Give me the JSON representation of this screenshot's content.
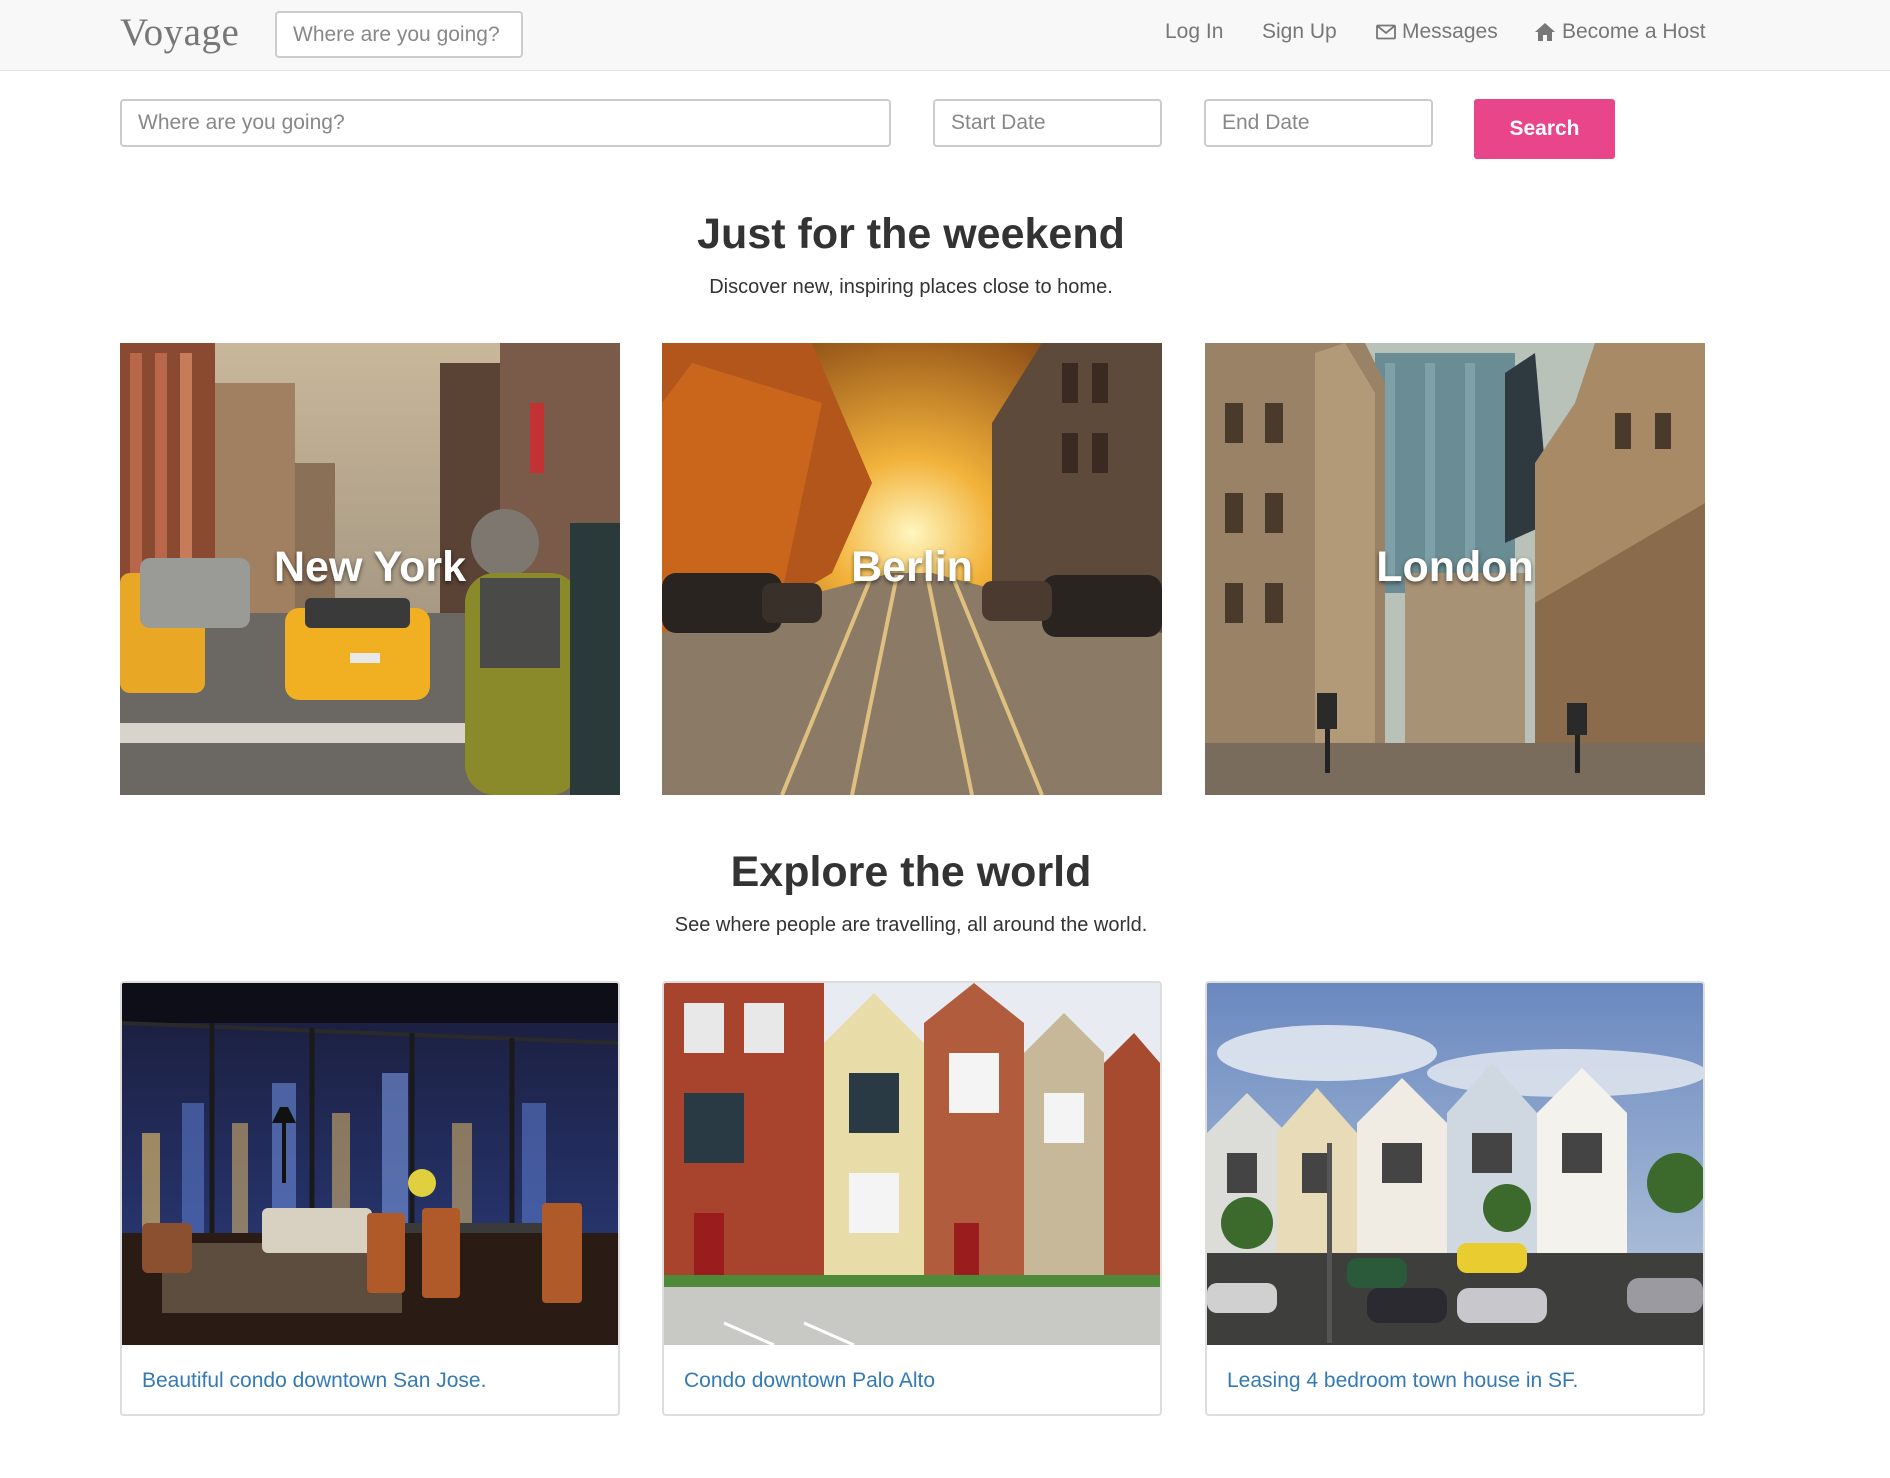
{
  "navbar": {
    "brand": "Voyage",
    "search_placeholder": "Where are you going?",
    "links": {
      "login": "Log In",
      "signup": "Sign Up",
      "messages": "Messages",
      "host": "Become a Host"
    }
  },
  "search": {
    "where_placeholder": "Where are you going?",
    "start_placeholder": "Start Date",
    "end_placeholder": "End Date",
    "button": "Search"
  },
  "weekend": {
    "title": "Just for the weekend",
    "subtitle": "Discover new, inspiring places close to home.",
    "cities": [
      "New York",
      "Berlin",
      "London"
    ]
  },
  "explore": {
    "title": "Explore the world",
    "subtitle": "See where people are travelling, all around the world.",
    "listings": [
      "Beautiful condo downtown San Jose.",
      "Condo downtown Palo Alto",
      "Leasing 4 bedroom town house in SF."
    ]
  },
  "colors": {
    "accent": "#e8458b",
    "link": "#337ab7",
    "navbar_bg": "#f8f8f8"
  }
}
